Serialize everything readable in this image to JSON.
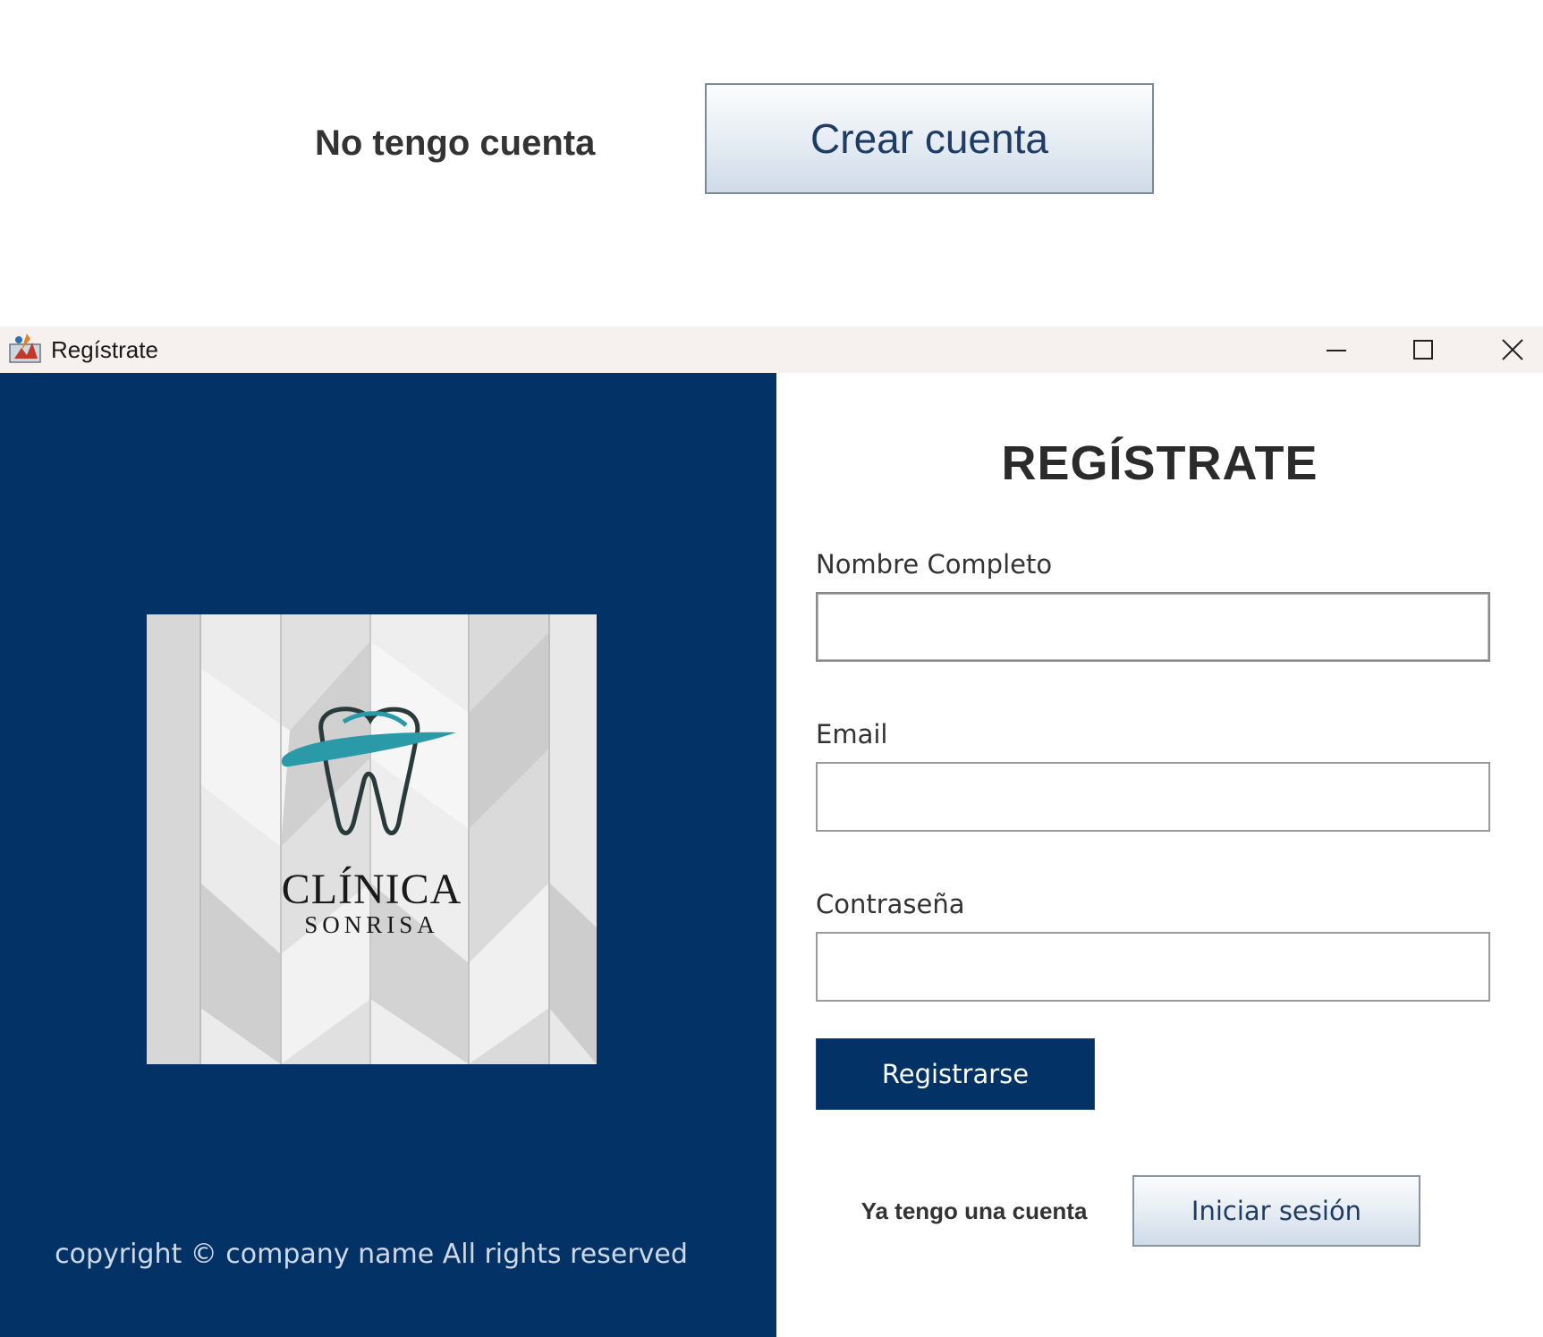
{
  "top_snippet": {
    "no_account_label": "No tengo cuenta",
    "create_account_button": "Crear cuenta"
  },
  "window": {
    "title": "Regístrate",
    "icon": "app-icon",
    "controls": [
      "minimize-icon",
      "maximize-icon",
      "close-icon"
    ]
  },
  "left_panel": {
    "background_color": "#033366",
    "logo": {
      "brand_line1": "CLÍNICA",
      "brand_line2": "SONRISA",
      "icon": "tooth-icon",
      "accent_color": "#2a9aa8"
    },
    "copyright": "copyright © company name All rights reserved"
  },
  "form": {
    "title": "REGÍSTRATE",
    "fields": [
      {
        "label": "Nombre Completo",
        "value": "",
        "placeholder": ""
      },
      {
        "label": "Email",
        "value": "",
        "placeholder": ""
      },
      {
        "label": "Contraseña",
        "value": "",
        "placeholder": ""
      }
    ],
    "register_button": "Registrarse",
    "have_account_label": "Ya tengo una cuenta",
    "login_button": "Iniciar sesión"
  }
}
